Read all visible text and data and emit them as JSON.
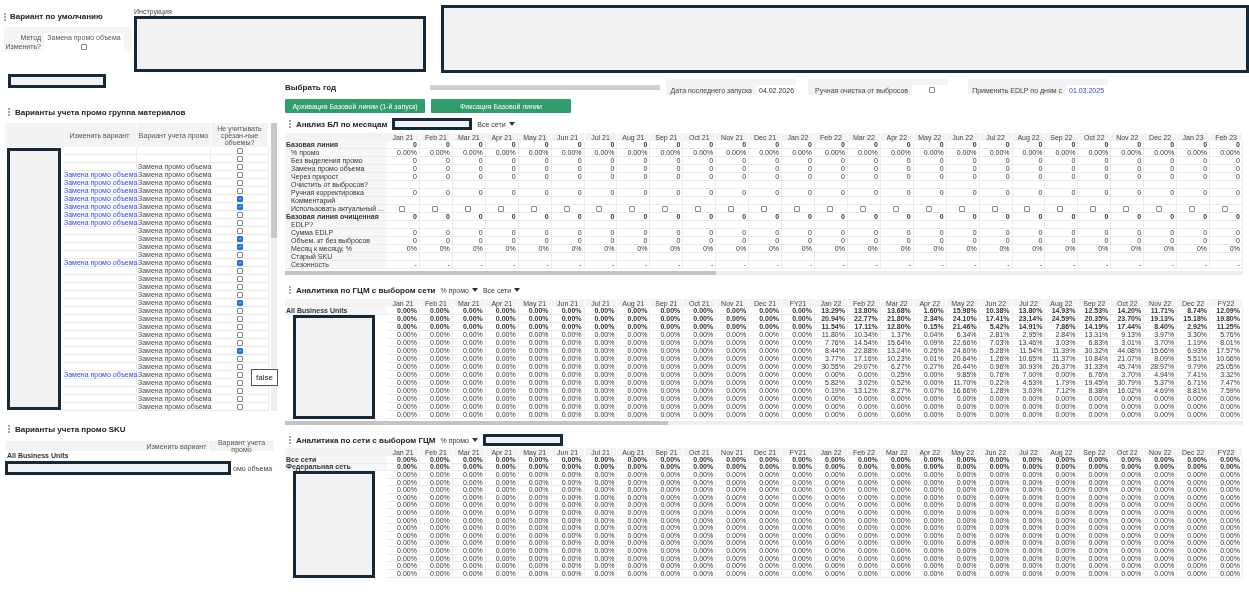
{
  "default_variant": {
    "title": "Вариант по умолчанию",
    "method_label": "Метод",
    "method_value": "Замена промо объема",
    "change_label": "Изменить?",
    "change_checked": false
  },
  "instructions": {
    "label": "Инструкция"
  },
  "year": {
    "label": "Выбрать год"
  },
  "last_run": {
    "label": "Дата последнего запуска",
    "value": "04.02.2026"
  },
  "manual_cleanup": {
    "label": "Ручная очистка от выбросов",
    "checked": false
  },
  "edlp": {
    "label": "Применить EDLP по дням с",
    "value": "01.03.2025"
  },
  "buttons": [
    "Архивация Базовой линии (1-й запуск)",
    "Фиксация Базовой линии"
  ],
  "material_variants": {
    "title": "Варианты учета промо группа материалов",
    "columns": [
      "Изменить вариант",
      "Вариант учета промо",
      "Не учитывать срезан-ные объемы?"
    ],
    "tooltip": "false",
    "rows": [
      {
        "checked": false
      },
      {
        "checked": false
      },
      {
        "variant": "Замена промо объема",
        "checked": false
      },
      {
        "change": "Замена промо объема",
        "variant": "Замена промо объема",
        "checked": false
      },
      {
        "change": "Замена промо объема",
        "variant": "Замена промо объема",
        "checked": false
      },
      {
        "change": "Замена промо объема",
        "variant": "Замена промо объема",
        "checked": false
      },
      {
        "change": "Замена промо объема",
        "variant": "Замена промо объема",
        "checked": true
      },
      {
        "change": "Замена промо объема",
        "variant": "Замена промо объема",
        "checked": true
      },
      {
        "change": "Замена промо объема",
        "variant": "Замена промо объема",
        "checked": false
      },
      {
        "change": "Замена промо объема",
        "variant": "Замена промо объема",
        "checked": false
      },
      {
        "variant": "Замена промо объема",
        "checked": false
      },
      {
        "variant": "Замена промо объема",
        "checked": true
      },
      {
        "variant": "Замена промо объема",
        "checked": true
      },
      {
        "variant": "Замена промо объема",
        "checked": false
      },
      {
        "change": "Замена промо объема",
        "variant": "Замена промо объема",
        "checked": true
      },
      {
        "variant": "Замена промо объема",
        "checked": false
      },
      {
        "variant": "Замена промо объема",
        "checked": false
      },
      {
        "variant": "Замена промо объема",
        "checked": false
      },
      {
        "variant": "Замена промо объема",
        "checked": false
      },
      {
        "variant": "Замена промо объема",
        "checked": true
      },
      {
        "variant": "Замена промо объема",
        "checked": false
      },
      {
        "variant": "Замена промо объема",
        "checked": false
      },
      {
        "variant": "Замена промо объема",
        "checked": false
      },
      {
        "variant": "Замена промо объема",
        "checked": false
      },
      {
        "variant": "Замена промо объема",
        "checked": false
      },
      {
        "variant": "Замена промо объема",
        "checked": true
      },
      {
        "variant": "Замена промо объема",
        "checked": false
      },
      {
        "variant": "Замена промо объема",
        "checked": false
      },
      {
        "change": "Замена промо объема",
        "variant": "Замена промо объема",
        "checked": false
      },
      {
        "variant": "Замена промо объема",
        "checked": false
      },
      {
        "variant": "Замена промо объема",
        "checked": false
      },
      {
        "variant": "Замена промо объема",
        "checked": false
      },
      {
        "variant": "Замена промо объема",
        "checked": false
      }
    ]
  },
  "sku_variants": {
    "title": "Варианты учета промо SKU",
    "columns": [
      "Изменить вариант",
      "Вариант учета промо"
    ],
    "row_label": "All Business Units",
    "partial_value": "омо объема"
  },
  "baseline_analysis": {
    "title": "Анализ БЛ по месяцам",
    "filter": "Все сети",
    "columns": [
      "Jan 21",
      "Feb 21",
      "Mar 21",
      "Apr 21",
      "May 21",
      "Jun 21",
      "Jul 21",
      "Aug 21",
      "Sep 21",
      "Oct 21",
      "Nov 21",
      "Dec 21",
      "Jan 22",
      "Feb 22",
      "Mar 22",
      "Apr 22",
      "May 22",
      "Jun 22",
      "Jul 22",
      "Aug 22",
      "Sep 22",
      "Oct 22",
      "Nov 22",
      "Dec 22",
      "Jan 23",
      "Feb 23"
    ],
    "rows": [
      {
        "label": "Базовая линия",
        "bold": true,
        "cells": [
          "0",
          "0",
          "0",
          "0",
          "0",
          "0",
          "0",
          "0",
          "0",
          "0",
          "0",
          "0",
          "0",
          "0",
          "0",
          "0",
          "0",
          "0",
          "0",
          "0",
          "0",
          "0",
          "0",
          "0",
          "0",
          "0"
        ]
      },
      {
        "label": "% промо",
        "bold": false,
        "cells": [
          "0.00%",
          "0.00%",
          "0.00%",
          "0.00%",
          "0.00%",
          "0.00%",
          "0.00%",
          "0.00%",
          "0.00%",
          "0.00%",
          "0.00%",
          "0.00%",
          "0.00%",
          "0.00%",
          "0.00%",
          "0.00%",
          "0.00%",
          "0.00%",
          "0.00%",
          "0.00%",
          "0.00%",
          "0.00%",
          "0.00%",
          "0.00%",
          "0.00%",
          "0.00%"
        ]
      },
      {
        "label": "Без выделения промо",
        "bold": false,
        "cells": [
          "0",
          "0",
          "0",
          "0",
          "0",
          "0",
          "0",
          "0",
          "0",
          "0",
          "0",
          "0",
          "0",
          "0",
          "0",
          "0",
          "0",
          "0",
          "0",
          "0",
          "0",
          "0",
          "0",
          "0",
          "0",
          "0"
        ]
      },
      {
        "label": "Замена промо объема",
        "bold": false,
        "cells": [
          "0",
          "0",
          "0",
          "0",
          "0",
          "0",
          "0",
          "0",
          "0",
          "0",
          "0",
          "0",
          "0",
          "0",
          "0",
          "0",
          "0",
          "0",
          "0",
          "0",
          "0",
          "0",
          "0",
          "0",
          "0",
          "0"
        ]
      },
      {
        "label": "Через прирост",
        "bold": false,
        "cells": [
          "0",
          "0",
          "0",
          "0",
          "0",
          "0",
          "0",
          "0",
          "0",
          "0",
          "0",
          "0",
          "0",
          "0",
          "0",
          "0",
          "0",
          "0",
          "0",
          "0",
          "0",
          "0",
          "0",
          "0",
          "0",
          "0"
        ]
      },
      {
        "label": "Очистить от выбросов?",
        "bold": false
      },
      {
        "label": "Ручная корректировка",
        "bold": false,
        "cells": [
          "0",
          "0",
          "0",
          "0",
          "0",
          "0",
          "0",
          "0",
          "0",
          "0",
          "0",
          "0",
          "0",
          "0",
          "0",
          "0",
          "0",
          "0",
          "0",
          "0",
          "0",
          "0",
          "0",
          "0",
          "0",
          "0"
        ]
      },
      {
        "label": "Комментарий",
        "bold": false
      },
      {
        "label": "Использовать актуальный ...",
        "bold": false,
        "checks": [
          false,
          false,
          false,
          false,
          false,
          false,
          false,
          false,
          false,
          false,
          false,
          false,
          false,
          false,
          false,
          false,
          false,
          false,
          false,
          false,
          false,
          false,
          false,
          false,
          false,
          false
        ]
      },
      {
        "label": "Базовая линия очищенная",
        "bold": true,
        "cells": [
          "0",
          "0",
          "0",
          "0",
          "0",
          "0",
          "0",
          "0",
          "0",
          "0",
          "0",
          "0",
          "0",
          "0",
          "0",
          "0",
          "0",
          "0",
          "0",
          "0",
          "0",
          "0",
          "0",
          "0",
          "0",
          "0"
        ]
      },
      {
        "label": "EDLP?",
        "bold": false
      },
      {
        "label": "Сумма EDLP",
        "bold": false,
        "cells": [
          "0",
          "0",
          "0",
          "0",
          "0",
          "0",
          "0",
          "0",
          "0",
          "0",
          "0",
          "0",
          "0",
          "0",
          "0",
          "0",
          "0",
          "0",
          "0",
          "0",
          "0",
          "0",
          "0",
          "0",
          "0",
          "0"
        ]
      },
      {
        "label": "Объем. кт без выбросов",
        "bold": false,
        "cells": [
          "0",
          "0",
          "0",
          "0",
          "0",
          "0",
          "0",
          "0",
          "0",
          "0",
          "0",
          "0",
          "0",
          "0",
          "0",
          "0",
          "0",
          "0",
          "0",
          "0",
          "0",
          "0",
          "0",
          "0",
          "0",
          "0"
        ]
      },
      {
        "label": "Месяц к месяцу, %",
        "bold": false,
        "cells": [
          "0%",
          "0%",
          "0%",
          "0%",
          "0%",
          "0%",
          "0%",
          "0%",
          "0%",
          "0%",
          "0%",
          "0%",
          "0%",
          "0%",
          "0%",
          "0%",
          "0%",
          "0%",
          "0%",
          "0%",
          "0%",
          "0%",
          "0%",
          "0%",
          "0%",
          "0%"
        ]
      },
      {
        "label": "Старый SKU",
        "bold": false
      },
      {
        "label": "Сезонность",
        "bold": false,
        "cells": [
          "-",
          "-",
          "-",
          "-",
          "-",
          "-",
          "-",
          "-",
          "-",
          "-",
          "-",
          "-",
          "-",
          "-",
          "-",
          "-",
          "-",
          "-",
          "-",
          "-",
          "-",
          "-",
          "-",
          "-",
          "-",
          "-"
        ]
      }
    ]
  },
  "gcm_analytics": {
    "title": "Аналитика по ГЦМ с выбором сети",
    "filters": [
      "% промо",
      "Все сети"
    ],
    "columns": [
      "Jan 21",
      "Feb 21",
      "Mar 21",
      "Apr 21",
      "May 21",
      "Jun 21",
      "Jul 21",
      "Aug 21",
      "Sep 21",
      "Oct 21",
      "Nov 21",
      "Dec 21",
      "FY21",
      "Jan 22",
      "Feb 22",
      "Mar 22",
      "Apr 22",
      "May 22",
      "Jun 22",
      "Jul 22",
      "Aug 22",
      "Sep 22",
      "Oct 22",
      "Nov 22",
      "Dec 22",
      "FY22"
    ],
    "rows": [
      {
        "label": "All Business Units",
        "bold": true,
        "cells": [
          "0.00%",
          "0.00%",
          "0.00%",
          "0.00%",
          "0.00%",
          "0.00%",
          "0.00%",
          "0.00%",
          "0.00%",
          "0.00%",
          "0.00%",
          "0.00%",
          "0.00%",
          "13.29%",
          "13.80%",
          "13.68%",
          "1.60%",
          "15.98%",
          "10.38%",
          "13.80%",
          "14.93%",
          "12.53%",
          "14.20%",
          "11.71%",
          "8.74%",
          "12.09%"
        ]
      },
      {
        "bold": true,
        "cells": [
          "0.00%",
          "0.00%",
          "0.00%",
          "0.00%",
          "0.00%",
          "0.00%",
          "0.00%",
          "0.00%",
          "0.00%",
          "0.00%",
          "0.00%",
          "0.00%",
          "0.00%",
          "20.94%",
          "22.77%",
          "21.80%",
          "2.34%",
          "24.10%",
          "17.41%",
          "23.14%",
          "24.59%",
          "20.35%",
          "23.70%",
          "19.13%",
          "15.18%",
          "19.80%"
        ]
      },
      {
        "bold": true,
        "cells": [
          "0.00%",
          "0.00%",
          "0.00%",
          "0.00%",
          "0.00%",
          "0.00%",
          "0.00%",
          "0.00%",
          "0.00%",
          "0.00%",
          "0.00%",
          "0.00%",
          "0.00%",
          "11.54%",
          "17.11%",
          "12.80%",
          "0.15%",
          "21.46%",
          "5.42%",
          "14.91%",
          "7.86%",
          "14.19%",
          "17.44%",
          "8.40%",
          "2.92%",
          "11.25%"
        ]
      },
      {
        "bold": false,
        "cells": [
          "0.00%",
          "0.00%",
          "0.00%",
          "0.00%",
          "0.00%",
          "0.00%",
          "0.00%",
          "0.00%",
          "0.00%",
          "0.00%",
          "0.00%",
          "0.00%",
          "0.00%",
          "11.80%",
          "10.34%",
          "1.37%",
          "0.04%",
          "6.34%",
          "2.81%",
          "2.95%",
          "2.84%",
          "13.31%",
          "9.13%",
          "3.97%",
          "3.30%",
          "5.76%"
        ]
      },
      {
        "bold": false,
        "cells": [
          "0.00%",
          "0.00%",
          "0.00%",
          "0.00%",
          "0.00%",
          "0.00%",
          "0.00%",
          "0.00%",
          "0.00%",
          "0.00%",
          "0.00%",
          "0.00%",
          "0.00%",
          "7.76%",
          "14.54%",
          "15.64%",
          "0.09%",
          "22.66%",
          "7.03%",
          "13.46%",
          "3.03%",
          "6.83%",
          "3.01%",
          "3.70%",
          "1.19%",
          "8.01%"
        ]
      },
      {
        "bold": false,
        "cells": [
          "0.00%",
          "0.00%",
          "0.00%",
          "0.00%",
          "0.00%",
          "0.00%",
          "0.00%",
          "0.00%",
          "0.00%",
          "0.00%",
          "0.00%",
          "0.00%",
          "0.00%",
          "8.44%",
          "22.88%",
          "13.24%",
          "0.26%",
          "24.60%",
          "5.28%",
          "11.54%",
          "11.39%",
          "30.32%",
          "44.08%",
          "15.66%",
          "6.93%",
          "17.57%"
        ]
      },
      {
        "bold": false,
        "cells": [
          "0.00%",
          "0.00%",
          "0.00%",
          "0.00%",
          "0.00%",
          "0.00%",
          "0.00%",
          "0.00%",
          "0.00%",
          "0.00%",
          "0.00%",
          "0.00%",
          "0.00%",
          "3.77%",
          "17.16%",
          "10.23%",
          "0.01%",
          "20.64%",
          "1.26%",
          "10.65%",
          "11.37%",
          "10.84%",
          "21.07%",
          "8.09%",
          "5.51%",
          "10.66%"
        ]
      },
      {
        "bold": false,
        "cells": [
          "0.00%",
          "0.00%",
          "0.00%",
          "0.00%",
          "0.00%",
          "0.00%",
          "0.00%",
          "0.00%",
          "0.00%",
          "0.00%",
          "0.00%",
          "0.00%",
          "0.00%",
          "30.55%",
          "29.07%",
          "6.27%",
          "0.27%",
          "26.44%",
          "0.96%",
          "30.93%",
          "26.37%",
          "31.33%",
          "45.74%",
          "28.97%",
          "9.79%",
          "25.05%"
        ]
      },
      {
        "bold": false,
        "cells": [
          "0.00%",
          "0.00%",
          "0.00%",
          "0.00%",
          "0.00%",
          "0.00%",
          "0.00%",
          "0.00%",
          "0.00%",
          "0.00%",
          "0.00%",
          "0.00%",
          "0.00%",
          "0.00%",
          "0.00%",
          "0.25%",
          "0.00%",
          "9.85%",
          "0.76%",
          "7.00%",
          "0.00%",
          "6.76%",
          "3.70%",
          "4.94%",
          "7.41%",
          "3.32%"
        ]
      },
      {
        "bold": false,
        "cells": [
          "0.00%",
          "0.00%",
          "0.00%",
          "0.00%",
          "0.00%",
          "0.00%",
          "0.00%",
          "0.00%",
          "0.00%",
          "0.00%",
          "0.00%",
          "0.00%",
          "0.00%",
          "5.82%",
          "3.02%",
          "0.52%",
          "0.00%",
          "11.70%",
          "0.22%",
          "4.53%",
          "1.79%",
          "19.45%",
          "30.79%",
          "5.37%",
          "6.71%",
          "7.47%"
        ]
      },
      {
        "bold": false,
        "cells": [
          "0.00%",
          "0.00%",
          "0.00%",
          "0.00%",
          "0.00%",
          "0.00%",
          "0.00%",
          "0.00%",
          "0.00%",
          "0.00%",
          "0.00%",
          "0.00%",
          "0.00%",
          "0.19%",
          "13.12%",
          "8.27%",
          "0.07%",
          "16.66%",
          "1.28%",
          "3.03%",
          "7.12%",
          "8.38%",
          "16.02%",
          "4.69%",
          "8.81%",
          "7.59%"
        ]
      },
      {
        "bold": false,
        "cells": [
          "0.00%",
          "0.00%",
          "0.00%",
          "0.00%",
          "0.00%",
          "0.00%",
          "0.00%",
          "0.00%",
          "0.00%",
          "0.00%",
          "0.00%",
          "0.00%",
          "0.00%",
          "0.00%",
          "0.00%",
          "0.00%",
          "0.00%",
          "0.00%",
          "0.00%",
          "0.00%",
          "0.00%",
          "0.00%",
          "0.00%",
          "0.00%",
          "0.00%",
          "0.00%"
        ]
      },
      {
        "bold": false,
        "cells": [
          "0.00%",
          "0.00%",
          "0.00%",
          "0.00%",
          "0.00%",
          "0.00%",
          "0.00%",
          "0.00%",
          "0.00%",
          "0.00%",
          "0.00%",
          "0.00%",
          "0.00%",
          "0.00%",
          "0.00%",
          "0.00%",
          "0.00%",
          "0.00%",
          "0.00%",
          "0.00%",
          "0.00%",
          "0.00%",
          "0.00%",
          "0.00%",
          "0.00%",
          "0.00%"
        ]
      },
      {
        "bold": false,
        "cells": [
          "0.00%",
          "0.00%",
          "0.00%",
          "0.00%",
          "0.00%",
          "0.00%",
          "0.00%",
          "0.00%",
          "0.00%",
          "0.00%",
          "0.00%",
          "0.00%",
          "0.00%",
          "0.00%",
          "0.00%",
          "0.00%",
          "0.00%",
          "0.00%",
          "0.00%",
          "0.00%",
          "0.00%",
          "0.00%",
          "0.00%",
          "0.00%",
          "0.00%",
          "0.00%"
        ]
      }
    ]
  },
  "network_analytics": {
    "title": "Аналитика по сети с выбором ГЦМ",
    "filters": [
      "% промо"
    ],
    "columns": [
      "Jan 21",
      "Feb 21",
      "Mar 21",
      "Apr 21",
      "May 21",
      "Jun 21",
      "Jul 21",
      "Aug 21",
      "Sep 21",
      "Oct 21",
      "Nov 21",
      "Dec 21",
      "FY21",
      "Jan 22",
      "Feb 22",
      "Mar 22",
      "Apr 22",
      "May 22",
      "Jun 22",
      "Jul 22",
      "Aug 22",
      "Sep 22",
      "Oct 22",
      "Nov 22",
      "Dec 22",
      "FY22"
    ],
    "rows": [
      {
        "label": "Все сети",
        "bold": true,
        "cells": [
          "0.00%",
          "0.00%",
          "0.00%",
          "0.00%",
          "0.00%",
          "0.00%",
          "0.00%",
          "0.00%",
          "0.00%",
          "0.00%",
          "0.00%",
          "0.00%",
          "0.00%",
          "0.00%",
          "0.00%",
          "0.00%",
          "0.00%",
          "0.00%",
          "0.00%",
          "0.00%",
          "0.00%",
          "0.00%",
          "0.00%",
          "0.00%",
          "0.00%",
          "0.00%"
        ]
      },
      {
        "label": "Федеральная сеть",
        "bold": true,
        "cells": [
          "0.00%",
          "0.00%",
          "0.00%",
          "0.00%",
          "0.00%",
          "0.00%",
          "0.00%",
          "0.00%",
          "0.00%",
          "0.00%",
          "0.00%",
          "0.00%",
          "0.00%",
          "0.00%",
          "0.00%",
          "0.00%",
          "0.00%",
          "0.00%",
          "0.00%",
          "0.00%",
          "0.00%",
          "0.00%",
          "0.00%",
          "0.00%",
          "0.00%",
          "0.00%"
        ]
      },
      {
        "bold": false,
        "cells": [
          "0.00%",
          "0.00%",
          "0.00%",
          "0.00%",
          "0.00%",
          "0.00%",
          "0.00%",
          "0.00%",
          "0.00%",
          "0.00%",
          "0.00%",
          "0.00%",
          "0.00%",
          "0.00%",
          "0.00%",
          "0.00%",
          "0.00%",
          "0.00%",
          "0.00%",
          "0.00%",
          "0.00%",
          "0.00%",
          "0.00%",
          "0.00%",
          "0.00%",
          "0.00%"
        ]
      },
      {
        "bold": false,
        "cells": [
          "0.00%",
          "0.00%",
          "0.00%",
          "0.00%",
          "0.00%",
          "0.00%",
          "0.00%",
          "0.00%",
          "0.00%",
          "0.00%",
          "0.00%",
          "0.00%",
          "0.00%",
          "0.00%",
          "0.00%",
          "0.00%",
          "0.00%",
          "0.00%",
          "0.00%",
          "0.00%",
          "0.00%",
          "0.00%",
          "0.00%",
          "0.00%",
          "0.00%",
          "0.00%"
        ]
      },
      {
        "bold": false,
        "cells": [
          "0.00%",
          "0.00%",
          "0.00%",
          "0.00%",
          "0.00%",
          "0.00%",
          "0.00%",
          "0.00%",
          "0.00%",
          "0.00%",
          "0.00%",
          "0.00%",
          "0.00%",
          "0.00%",
          "0.00%",
          "0.00%",
          "0.00%",
          "0.00%",
          "0.00%",
          "0.00%",
          "0.00%",
          "0.00%",
          "0.00%",
          "0.00%",
          "0.00%",
          "0.00%"
        ]
      },
      {
        "bold": false,
        "cells": [
          "0.00%",
          "0.00%",
          "0.00%",
          "0.00%",
          "0.00%",
          "0.00%",
          "0.00%",
          "0.00%",
          "0.00%",
          "0.00%",
          "0.00%",
          "0.00%",
          "0.00%",
          "0.00%",
          "0.00%",
          "0.00%",
          "0.00%",
          "0.00%",
          "0.00%",
          "0.00%",
          "0.00%",
          "0.00%",
          "0.00%",
          "0.00%",
          "0.00%",
          "0.00%"
        ]
      },
      {
        "bold": false,
        "cells": [
          "0.00%",
          "0.00%",
          "0.00%",
          "0.00%",
          "0.00%",
          "0.00%",
          "0.00%",
          "0.00%",
          "0.00%",
          "0.00%",
          "0.00%",
          "0.00%",
          "0.00%",
          "0.00%",
          "0.00%",
          "0.00%",
          "0.00%",
          "0.00%",
          "0.00%",
          "0.00%",
          "0.00%",
          "0.00%",
          "0.00%",
          "0.00%",
          "0.00%",
          "0.00%"
        ]
      },
      {
        "bold": false,
        "cells": [
          "0.00%",
          "0.00%",
          "0.00%",
          "0.00%",
          "0.00%",
          "0.00%",
          "0.00%",
          "0.00%",
          "0.00%",
          "0.00%",
          "0.00%",
          "0.00%",
          "0.00%",
          "0.00%",
          "0.00%",
          "0.00%",
          "0.00%",
          "0.00%",
          "0.00%",
          "0.00%",
          "0.00%",
          "0.00%",
          "0.00%",
          "0.00%",
          "0.00%",
          "0.00%"
        ]
      },
      {
        "bold": false,
        "cells": [
          "0.00%",
          "0.00%",
          "0.00%",
          "0.00%",
          "0.00%",
          "0.00%",
          "0.00%",
          "0.00%",
          "0.00%",
          "0.00%",
          "0.00%",
          "0.00%",
          "0.00%",
          "0.00%",
          "0.00%",
          "0.00%",
          "0.00%",
          "0.00%",
          "0.00%",
          "0.00%",
          "0.00%",
          "0.00%",
          "0.00%",
          "0.00%",
          "0.00%",
          "0.00%"
        ]
      },
      {
        "bold": false,
        "cells": [
          "0.00%",
          "0.00%",
          "0.00%",
          "0.00%",
          "0.00%",
          "0.00%",
          "0.00%",
          "0.00%",
          "0.00%",
          "0.00%",
          "0.00%",
          "0.00%",
          "0.00%",
          "0.00%",
          "0.00%",
          "0.00%",
          "0.00%",
          "0.00%",
          "0.00%",
          "0.00%",
          "0.00%",
          "0.00%",
          "0.00%",
          "0.00%",
          "0.00%",
          "0.00%"
        ]
      },
      {
        "bold": false,
        "cells": [
          "0.00%",
          "0.00%",
          "0.00%",
          "0.00%",
          "0.00%",
          "0.00%",
          "0.00%",
          "0.00%",
          "0.00%",
          "0.00%",
          "0.00%",
          "0.00%",
          "0.00%",
          "0.00%",
          "0.00%",
          "0.00%",
          "0.00%",
          "0.00%",
          "0.00%",
          "0.00%",
          "0.00%",
          "0.00%",
          "0.00%",
          "0.00%",
          "0.00%",
          "0.00%"
        ]
      },
      {
        "bold": false,
        "cells": [
          "0.00%",
          "0.00%",
          "0.00%",
          "0.00%",
          "0.00%",
          "0.00%",
          "0.00%",
          "0.00%",
          "0.00%",
          "0.00%",
          "0.00%",
          "0.00%",
          "0.00%",
          "0.00%",
          "0.00%",
          "0.00%",
          "0.00%",
          "0.00%",
          "0.00%",
          "0.00%",
          "0.00%",
          "0.00%",
          "0.00%",
          "0.00%",
          "0.00%",
          "0.00%"
        ]
      },
      {
        "bold": false,
        "cells": [
          "0.00%",
          "0.00%",
          "0.00%",
          "0.00%",
          "0.00%",
          "0.00%",
          "0.00%",
          "0.00%",
          "0.00%",
          "0.00%",
          "0.00%",
          "0.00%",
          "0.00%",
          "0.00%",
          "0.00%",
          "0.00%",
          "0.00%",
          "0.00%",
          "0.00%",
          "0.00%",
          "0.00%",
          "0.00%",
          "0.00%",
          "0.00%",
          "0.00%",
          "0.00%"
        ]
      },
      {
        "bold": false,
        "cells": [
          "0.00%",
          "0.00%",
          "0.00%",
          "0.00%",
          "0.00%",
          "0.00%",
          "0.00%",
          "0.00%",
          "0.00%",
          "0.00%",
          "0.00%",
          "0.00%",
          "0.00%",
          "0.00%",
          "0.00%",
          "0.00%",
          "0.00%",
          "0.00%",
          "0.00%",
          "0.00%",
          "0.00%",
          "0.00%",
          "0.00%",
          "0.00%",
          "0.00%",
          "0.00%"
        ]
      },
      {
        "bold": false,
        "cells": [
          "0.00%",
          "0.00%",
          "0.00%",
          "0.00%",
          "0.00%",
          "0.00%",
          "0.00%",
          "0.00%",
          "0.00%",
          "0.00%",
          "0.00%",
          "0.00%",
          "0.00%",
          "0.00%",
          "0.00%",
          "0.00%",
          "0.00%",
          "0.00%",
          "0.00%",
          "0.00%",
          "0.00%",
          "0.00%",
          "0.00%",
          "0.00%",
          "0.00%",
          "0.00%"
        ]
      },
      {
        "bold": false,
        "cells": [
          "0.00%",
          "0.00%",
          "0.00%",
          "0.00%",
          "0.00%",
          "0.00%",
          "0.00%",
          "0.00%",
          "0.00%",
          "0.00%",
          "0.00%",
          "0.00%",
          "0.00%",
          "0.00%",
          "0.00%",
          "0.00%",
          "0.00%",
          "0.00%",
          "0.00%",
          "0.00%",
          "0.00%",
          "0.00%",
          "0.00%",
          "0.00%",
          "0.00%",
          "0.00%"
        ]
      }
    ]
  }
}
